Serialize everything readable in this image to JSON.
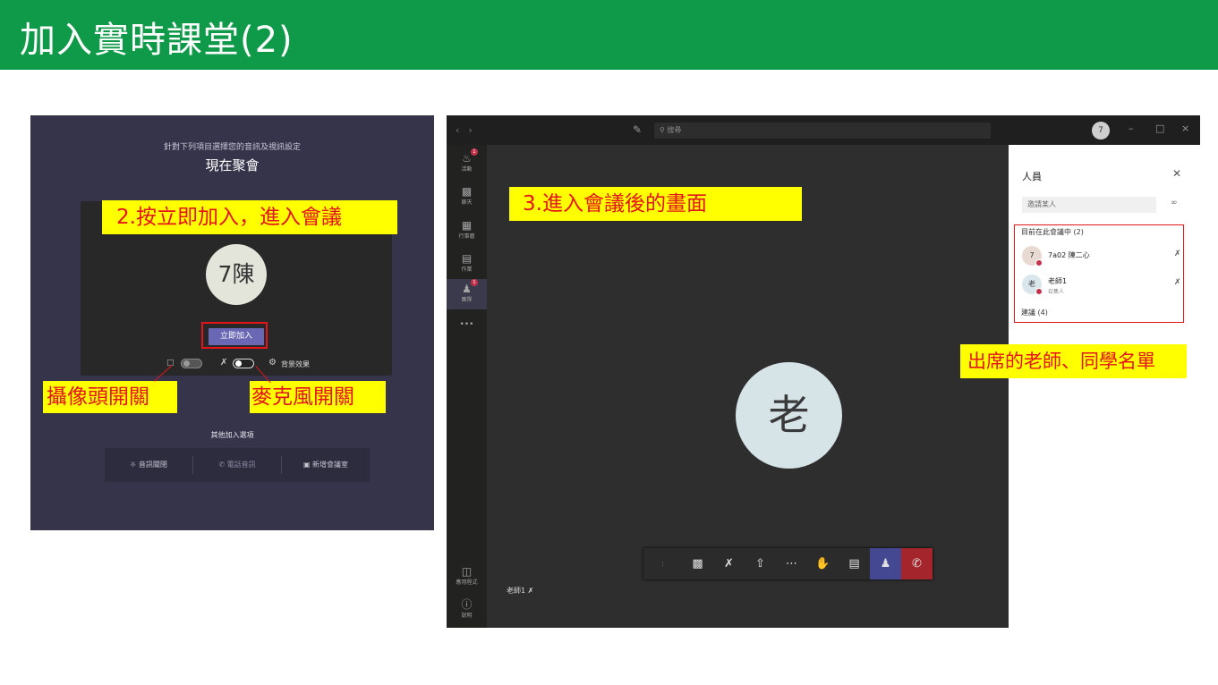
{
  "slide": {
    "title": "加入實時課堂(2)"
  },
  "prejoin": {
    "hint": "針對下列項目選擇您的音訊及視訊設定",
    "title": "現在聚會",
    "avatar_text": "7陳",
    "join_button": "立即加入",
    "camera_icon": "video-off-icon",
    "mic_icon": "mic-off-icon",
    "background_label": "背景效果",
    "other_join_title": "其他加入選項",
    "audio_options": [
      "音訊關閉",
      "電話音訊",
      "新增會議室"
    ]
  },
  "meeting": {
    "search_placeholder": "搜尋",
    "me_avatar": "7",
    "window_controls": [
      "–",
      "□",
      "×"
    ],
    "rail": [
      {
        "label": "活動",
        "icon": "bell-icon",
        "badge": "1"
      },
      {
        "label": "聊天",
        "icon": "chat-icon"
      },
      {
        "label": "行事曆",
        "icon": "calendar-icon"
      },
      {
        "label": "作業",
        "icon": "assignment-icon"
      },
      {
        "label": "團隊",
        "icon": "teams-icon",
        "badge": "1"
      }
    ],
    "rail_more": "•••",
    "rail_bottom": [
      {
        "label": "應用程式",
        "icon": "apps-icon"
      },
      {
        "label": "說明",
        "icon": "help-icon"
      }
    ],
    "stage_avatar": "老",
    "self_label": "老師1",
    "controls_first": ":",
    "people_panel": {
      "title": "人員",
      "invite_placeholder": "邀請某人",
      "in_meeting": "目前在此會議中 (2)",
      "participants": [
        {
          "avatar": "7",
          "name": "7a02 陳二心",
          "role": ""
        },
        {
          "avatar": "老",
          "name": "老師1",
          "role": "召集人"
        }
      ],
      "suggested": "建議 (4)"
    }
  },
  "annotations": {
    "step2": "2.按立即加入，進入會議",
    "camera": "攝像頭開關",
    "mic": "麥克風開關",
    "step3": "3.進入會議後的畫面",
    "attendees": "出席的老師、同學名單"
  },
  "colors": {
    "banner": "#0e9a48",
    "highlight": "#ffff00",
    "annotation_text": "#e4141a",
    "join_button": "#6a67b5",
    "hangup": "#a4262c",
    "people_active": "#444791"
  }
}
